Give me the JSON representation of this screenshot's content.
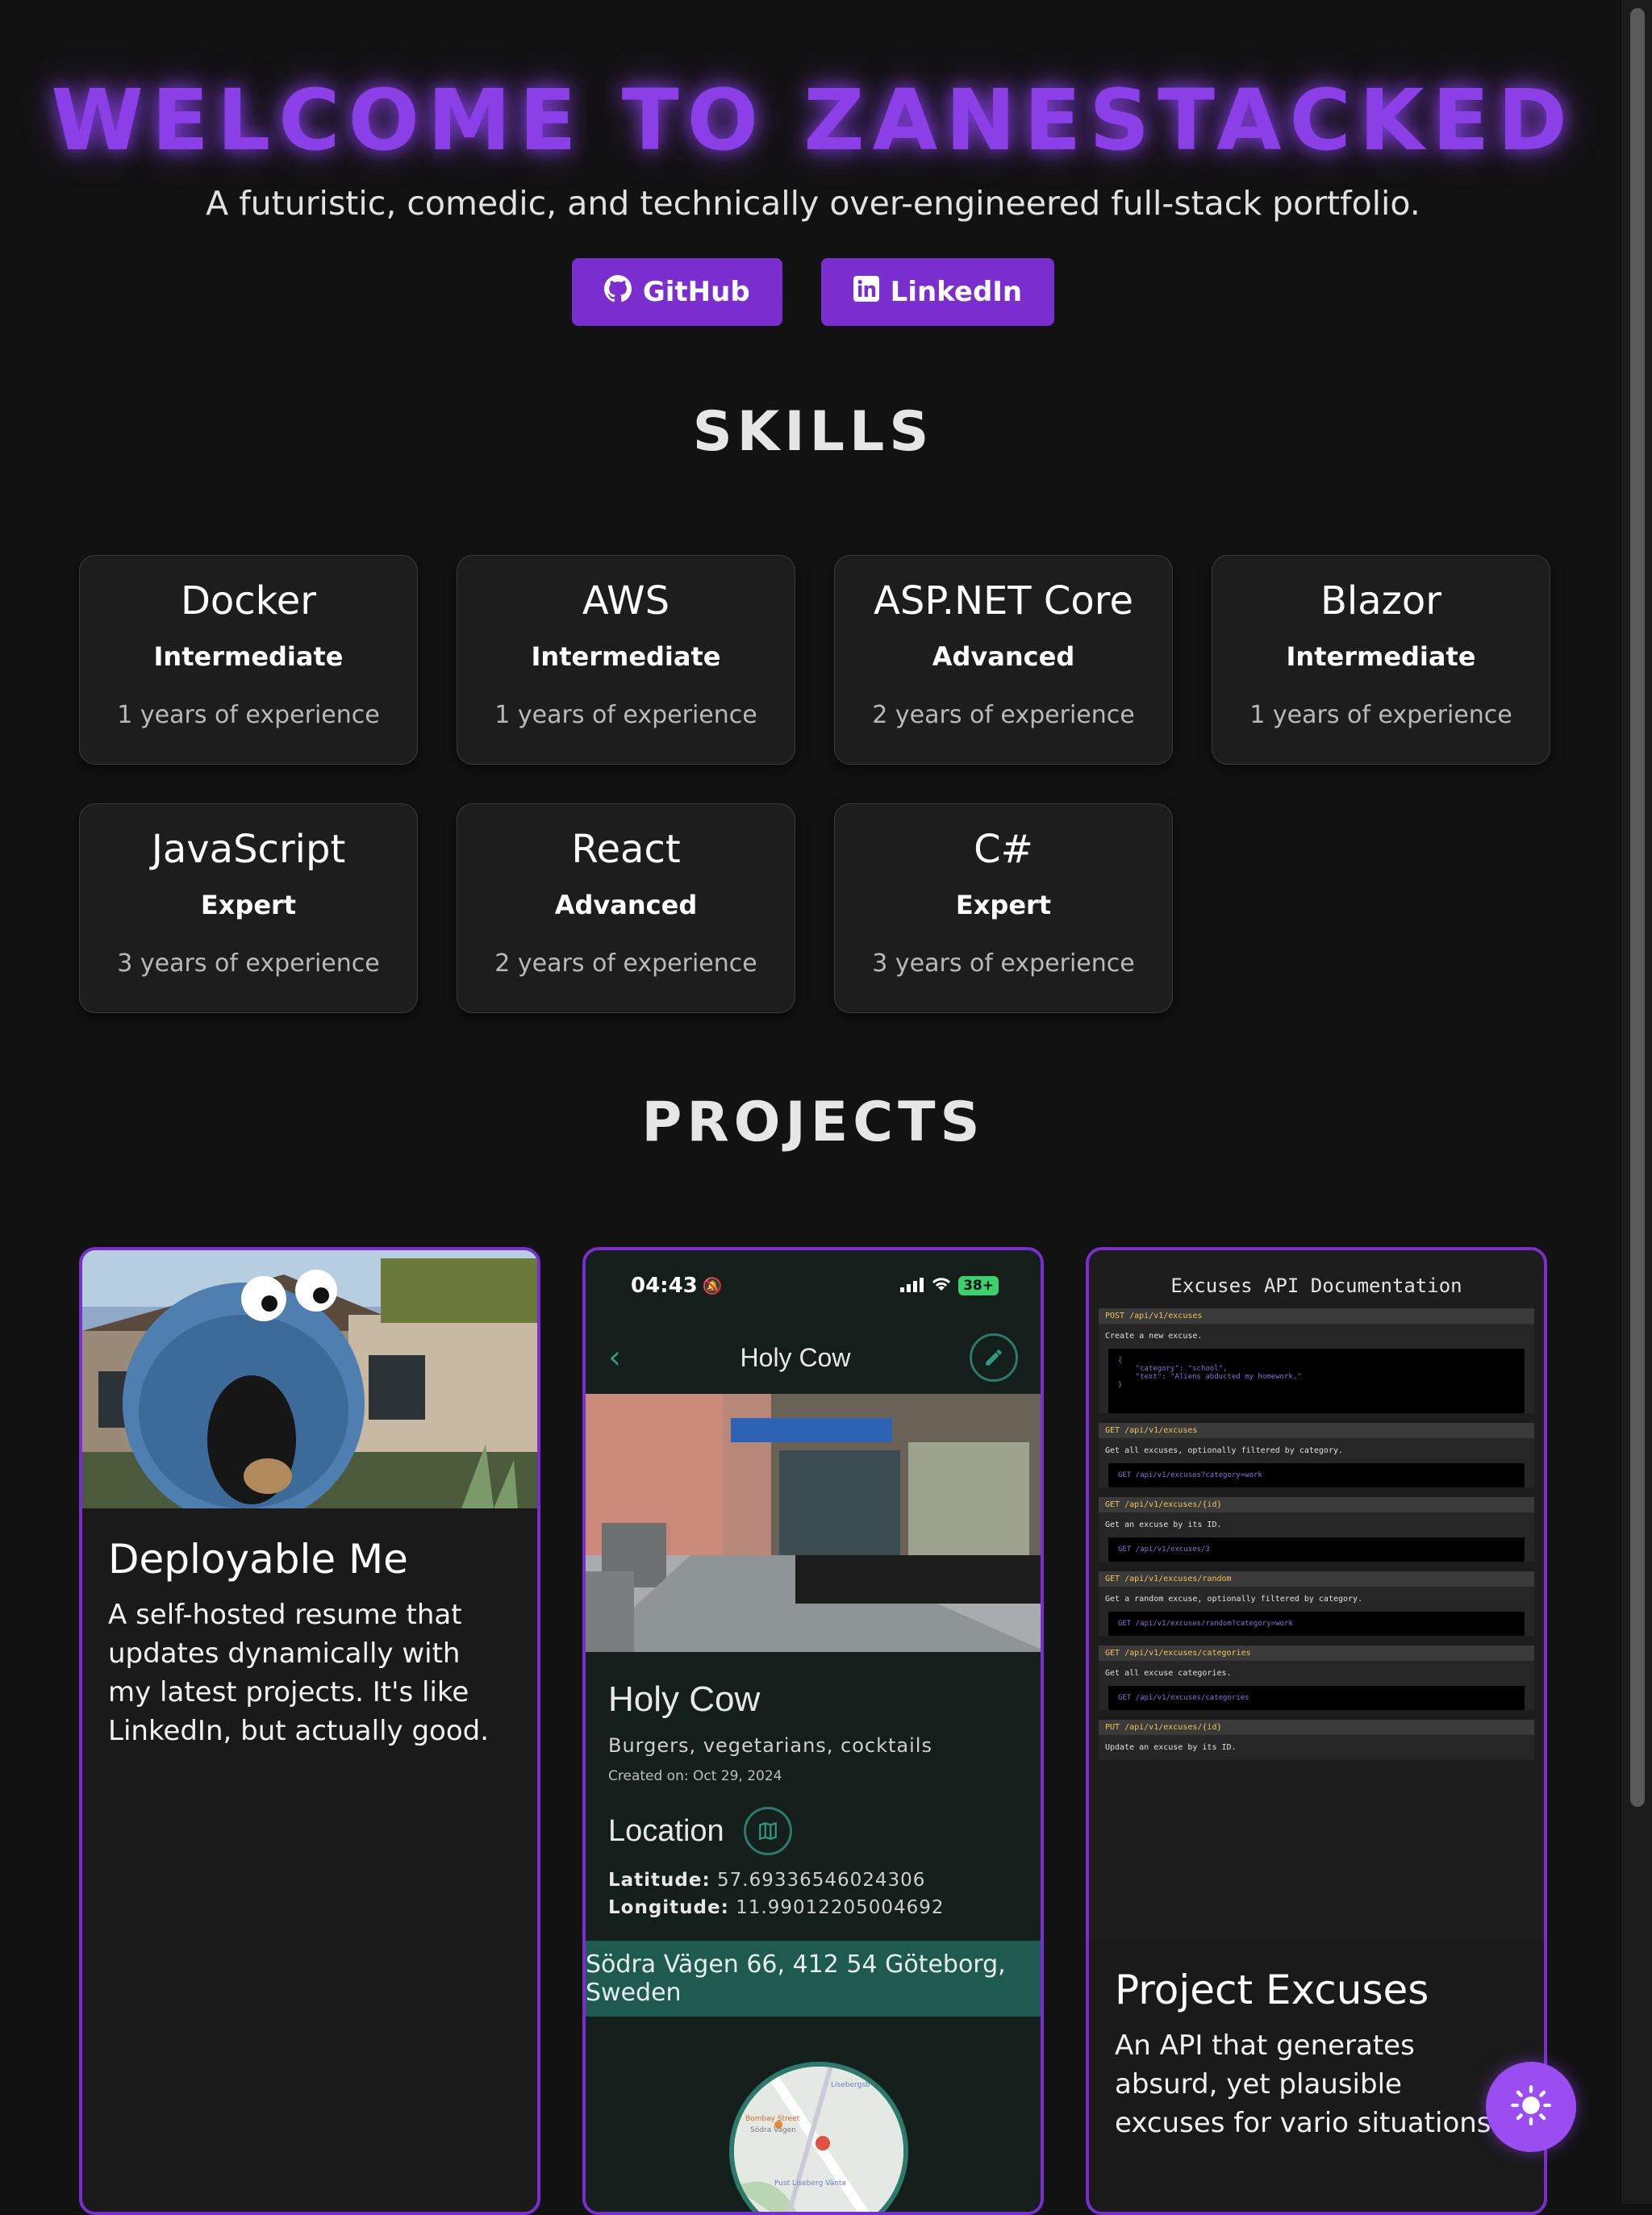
{
  "hero": {
    "title": "WELCOME TO ZANESTACKED",
    "subtitle": "A futuristic, comedic, and technically over-engineered full-stack portfolio.",
    "buttons": [
      {
        "label": "GitHub",
        "icon": "github-icon"
      },
      {
        "label": "LinkedIn",
        "icon": "linkedin-icon"
      }
    ]
  },
  "skills": {
    "title": "SKILLS",
    "items": [
      {
        "name": "Docker",
        "level": "Intermediate",
        "years": "1 years of experience"
      },
      {
        "name": "AWS",
        "level": "Intermediate",
        "years": "1 years of experience"
      },
      {
        "name": "ASP.NET Core",
        "level": "Advanced",
        "years": "2 years of experience"
      },
      {
        "name": "Blazor",
        "level": "Intermediate",
        "years": "1 years of experience"
      },
      {
        "name": "JavaScript",
        "level": "Expert",
        "years": "3 years of experience"
      },
      {
        "name": "React",
        "level": "Advanced",
        "years": "2 years of experience"
      },
      {
        "name": "C#",
        "level": "Expert",
        "years": "3 years of experience"
      }
    ]
  },
  "projects": {
    "title": "PROJECTS",
    "items": [
      {
        "title": "Deployable Me",
        "description": "A self-hosted resume that updates dynamically with my latest projects. It's like LinkedIn, but actually good."
      },
      {
        "phone": {
          "time": "04:43",
          "battery": "38+",
          "nav_title": "Holy Cow",
          "name": "Holy Cow",
          "tags": "Burgers, vegetarians, cocktails",
          "created": "Created on: Oct 29, 2024",
          "location_heading": "Location",
          "lat_label": "Latitude:",
          "lat": "57.69336546024306",
          "lon_label": "Longitude:",
          "lon": "11.99012205004692",
          "address": "Södra Vägen 66, 412 54 Göteborg, Sweden",
          "map_labels": [
            "Lisebergsb",
            "Bombay Street",
            "Södra Vägen",
            "Pust Liseberg Vänta"
          ]
        }
      },
      {
        "title": "Project Excuses",
        "description": "An API that generates absurd, yet plausible excuses for vario situations.",
        "api": {
          "heading": "Excuses API Documentation",
          "endpoints": [
            {
              "route": "POST /api/v1/excuses",
              "desc": "Create a new excuse.",
              "code": "{\n    \"category\": \"school\",\n    \"text\": \"Aliens abducted my homework.\"\n}"
            },
            {
              "route": "GET /api/v1/excuses",
              "desc": "Get all excuses, optionally filtered by category.",
              "code": "GET /api/v1/excuses?category=work"
            },
            {
              "route": "GET /api/v1/excuses/{id}",
              "desc": "Get an excuse by its ID.",
              "code": "GET /api/v1/excuses/3"
            },
            {
              "route": "GET /api/v1/excuses/random",
              "desc": "Get a random excuse, optionally filtered by category.",
              "code": "GET /api/v1/excuses/random?category=work"
            },
            {
              "route": "GET /api/v1/excuses/categories",
              "desc": "Get all excuse categories.",
              "code": "GET /api/v1/excuses/categories"
            },
            {
              "route": "PUT /api/v1/excuses/{id}",
              "desc": "Update an excuse by its ID.",
              "code": ""
            }
          ]
        }
      }
    ]
  },
  "theme_toggle": {
    "icon": "sun-icon"
  },
  "colors": {
    "accent": "#7a2ecf",
    "glow": "#8b3fe6",
    "background": "#121212",
    "card": "#1d1d1d",
    "teal": "#1e5a50"
  }
}
